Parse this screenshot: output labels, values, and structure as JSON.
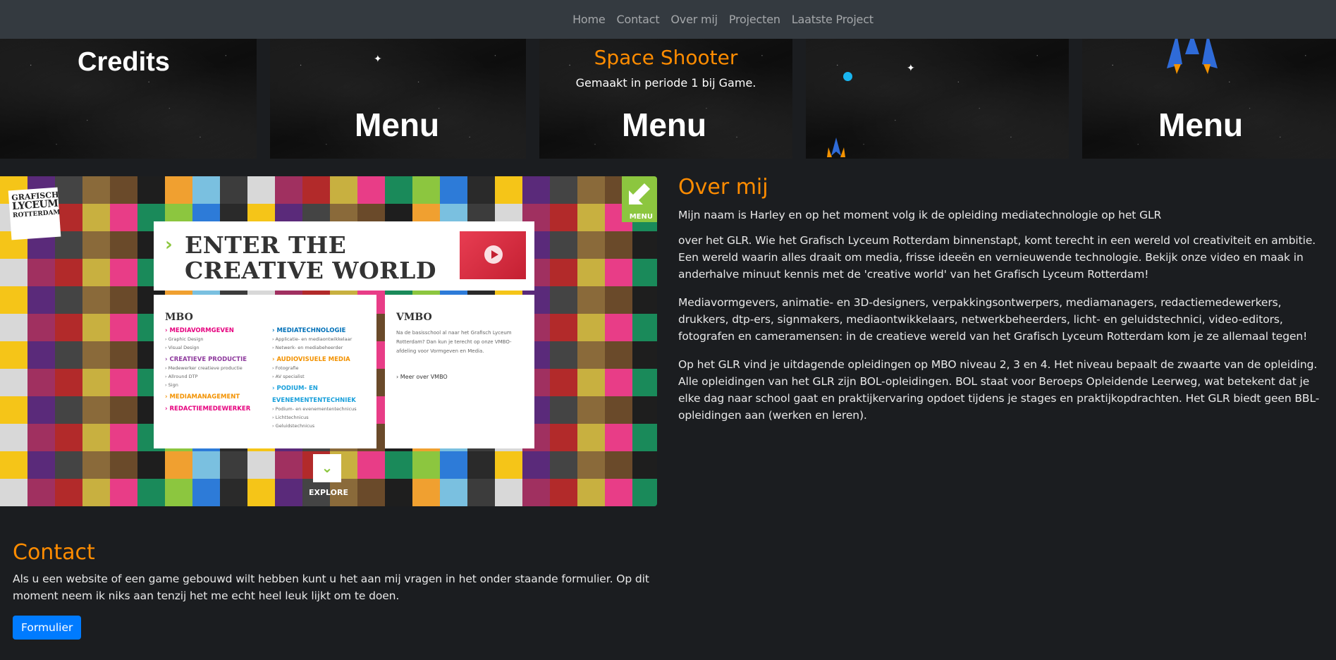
{
  "nav": {
    "items": [
      "Home",
      "Contact",
      "Over mij",
      "Projecten",
      "Laatste Project"
    ]
  },
  "game_strip": {
    "panel1_word": "Credits",
    "panel2_word": "Menu",
    "panel3_word": "Menu",
    "panel5_word": "Menu",
    "caption_title": "Space Shooter",
    "caption_text": "Gemaakt in periode 1 bij Game."
  },
  "creative_image": {
    "logo_line1": "GRAFISCH",
    "logo_line2": "LYCEUM",
    "logo_line3": "ROTTERDAM",
    "menu": "MENU",
    "headline1": "ENTER THE",
    "headline2": "CREATIVE WORLD",
    "mbo": {
      "heading": "MBO",
      "col1": [
        {
          "course": "› MEDIAVORMGEVEN",
          "subs": [
            "› Graphic Design",
            "› Visual Design"
          ]
        },
        {
          "course": "› CREATIEVE PRODUCTIE",
          "subs": [
            "› Medewerker creatieve productie",
            "› Allround DTP",
            "› Sign"
          ]
        },
        {
          "course": "› MEDIAMANAGEMENT",
          "subs": []
        },
        {
          "course": "› REDACTIEMEDEWERKER",
          "subs": []
        }
      ],
      "col2": [
        {
          "course": "› MEDIATECHNOLOGIE",
          "subs": [
            "› Applicatie- en mediaontwikkelaar",
            "› Netwerk- en mediabeheerder"
          ]
        },
        {
          "course": "› AUDIOVISUELE MEDIA",
          "subs": [
            "› Fotografie",
            "› AV specialist"
          ]
        },
        {
          "course": "› PODIUM- EN",
          "subs": []
        },
        {
          "course": "EVENEMENTENTECHNIEK",
          "subs": [
            "› Podium- en evenemententechnicus",
            "› Lichttechnicus",
            "› Geluidstechnicus"
          ]
        }
      ]
    },
    "vmbo": {
      "heading": "VMBO",
      "text": "Na de basisschool al naar het Grafisch Lyceum Rotterdam? Dan kun je terecht op onze VMBO-afdeling voor Vormgeven en Media.",
      "link": "› Meer over VMBO"
    },
    "explore": "EXPLORE",
    "colors": {
      "mediavormgeven": "#e6007e",
      "creatieve_productie": "#8e3a9d",
      "mediamanagement": "#f39200",
      "redactiemedewerker": "#e6007e",
      "mediatechnologie": "#0070b8",
      "audiovisuele_media": "#f39200",
      "podium": "#1aa0db",
      "green": "#8cc63f"
    }
  },
  "over_mij": {
    "title": "Over mij",
    "paragraphs": [
      "Mijn naam is Harley en op het moment volg ik de opleiding mediatechnologie op het GLR",
      "over het GLR. Wie het Grafisch Lyceum Rotterdam binnenstapt, komt terecht in een wereld vol creativiteit en ambitie. Een wereld waarin alles draait om media, frisse ideeën en vernieuwende technologie. Bekijk onze video en maak in anderhalve minuut kennis met de 'creative world' van het Grafisch Lyceum Rotterdam!",
      "Mediavormgevers, animatie- en 3D-designers, verpakkingsontwerpers, mediamanagers, redactiemedewerkers, drukkers, dtp-ers, signmakers, mediaontwikkelaars, netwerkbeheerders, licht- en geluidstechnici, video-editors, fotografen en cameramensen: in de creatieve wereld van het Grafisch Lyceum Rotterdam kom je ze allemaal tegen!",
      "Op het GLR vind je uitdagende opleidingen op MBO niveau 2, 3 en 4. Het niveau bepaalt de zwaarte van de opleiding. Alle opleidingen van het GLR zijn BOL-opleidingen. BOL staat voor Beroeps Opleidende Leerweg, wat betekent dat je elke dag naar school gaat en praktijkervaring opdoet tijdens je stages en praktijkopdrachten. Het GLR biedt geen BBL-opleidingen aan (werken en leren)."
    ]
  },
  "contact": {
    "title": "Contact",
    "text": "Als u een website of een game gebouwd wilt hebben kunt u het aan mij vragen in het onder staande formulier. Op dit moment neem ik niks aan tenzij het me echt heel leuk lijkt om te doen.",
    "button": "Formulier"
  },
  "colors": {
    "background": "#1b1d20",
    "navbar": "#343a40",
    "accent_orange": "#ff8c00",
    "button_blue": "#007bff"
  }
}
